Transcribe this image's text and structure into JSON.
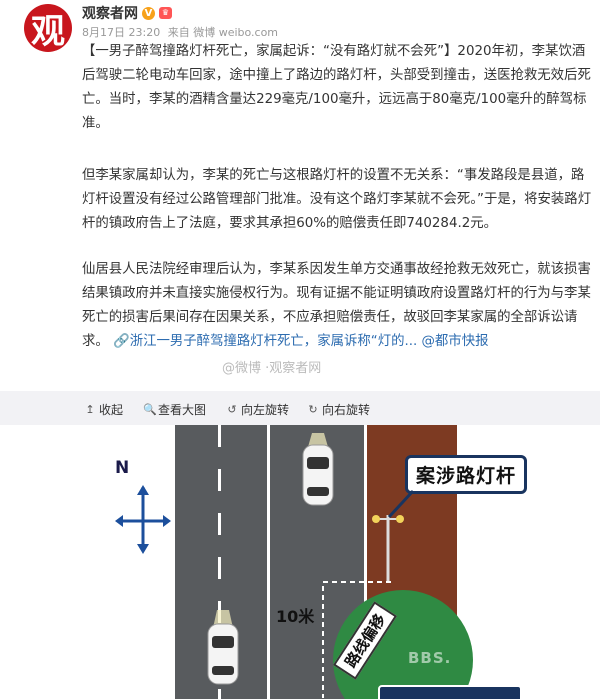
{
  "account": {
    "avatar_text": "观",
    "name": "观察者网",
    "verified_mark": "V",
    "date": "8月17日 23:20",
    "source": "来自 微博 weibo.com"
  },
  "post": {
    "p1": "【一男子醉驾撞路灯杆死亡，家属起诉：“没有路灯就不会死”】2020年初，李某饮酒后驾驶二轮电动车回家，途中撞上了路边的路灯杆，头部受到撞击，送医抢救无效后死亡。当时，李某的酒精含量达229毫克/100毫升，远远高于80毫克/100毫升的醉驾标准。",
    "p2": "但李某家属却认为，李某的死亡与这根路灯杆的设置不无关系：“事发路段是县道，路灯杆设置没有经过公路管理部门批准。没有这个路灯李某就不会死。”于是，将安装路灯杆的镇政府告上了法庭，要求其承担60%的赔偿责任即740284.2元。",
    "p3": "仙居县人民法院经审理后认为，李某系因发生单方交通事故经抢救无效死亡，就该损害结果镇政府并未直接实施侵权行为。现有证据不能证明镇政府设置路灯杆的行为与李某死亡的损害后果间存在因果关系，不应承担赔偿责任，故驳回李某家属的全部诉讼请求。",
    "link_text": "浙江一男子醉驾撞路灯杆死亡，家属诉称“灯的...",
    "mention": "@都市快报"
  },
  "toolbar": {
    "collapse": "收起",
    "view_large": "查看大图",
    "rotate_left": "向左旋转",
    "rotate_right": "向右旋转"
  },
  "image": {
    "north_label": "N",
    "lamp_label": "案涉路灯杆",
    "distance_label": "10米",
    "route_label": "路线偏移",
    "watermark": "BBS.",
    "weibo_watermark": "@微博 ·观察者网",
    "colors": {
      "road": "#585b5e",
      "dirt": "#7d3a22",
      "grass": "#2f8a43",
      "label_border": "#19345f"
    }
  }
}
